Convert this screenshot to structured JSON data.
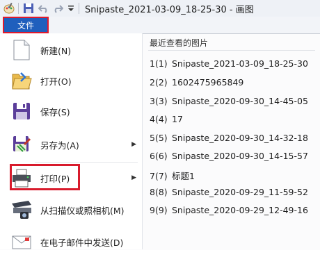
{
  "titlebar": {
    "title": "Snipaste_2021-03-09_18-25-30 - 画图",
    "icons": [
      "paint-app-icon",
      "save-icon",
      "undo-icon",
      "redo-icon",
      "customize-quick-access-icon"
    ]
  },
  "menubar": {
    "file_tab": "文件"
  },
  "menu": {
    "items": [
      {
        "label": "新建(N)",
        "icon": "new-file-icon"
      },
      {
        "label": "打开(O)",
        "icon": "open-folder-icon"
      },
      {
        "label": "保存(S)",
        "icon": "save-icon"
      },
      {
        "label": "另存为(A)",
        "icon": "save-as-icon",
        "submenu": true
      },
      {
        "label": "打印(P)",
        "icon": "printer-icon",
        "submenu": true
      },
      {
        "label": "从扫描仪或照相机(M)",
        "icon": "scanner-icon"
      },
      {
        "label": "在电子邮件中发送(D)",
        "icon": "email-icon"
      }
    ],
    "submenu_arrow": "▶"
  },
  "recent": {
    "header": "最近查看的图片",
    "items": [
      {
        "num": "1(1)",
        "name": "Snipaste_2021-03-09_18-25-30"
      },
      {
        "num": "2(2)",
        "name": "1602475965849"
      },
      {
        "num": "3(3)",
        "name": "Snipaste_2020-09-30_14-45-05"
      },
      {
        "num": "4(4)",
        "name": "17"
      },
      {
        "num": "5(5)",
        "name": "Snipaste_2020-09-30_14-32-18"
      },
      {
        "num": "6(6)",
        "name": "Snipaste_2020-09-30_14-15-57"
      },
      {
        "num": "7(7)",
        "name": "标题1"
      },
      {
        "num": "8(8)",
        "name": "Snipaste_2020-09-29_11-59-52"
      },
      {
        "num": "9(9)",
        "name": "Snipaste_2020-09-29_12-49-16"
      }
    ]
  },
  "colors": {
    "file_tab_bg": "#1f5fbd",
    "highlight": "#d81b2c"
  }
}
